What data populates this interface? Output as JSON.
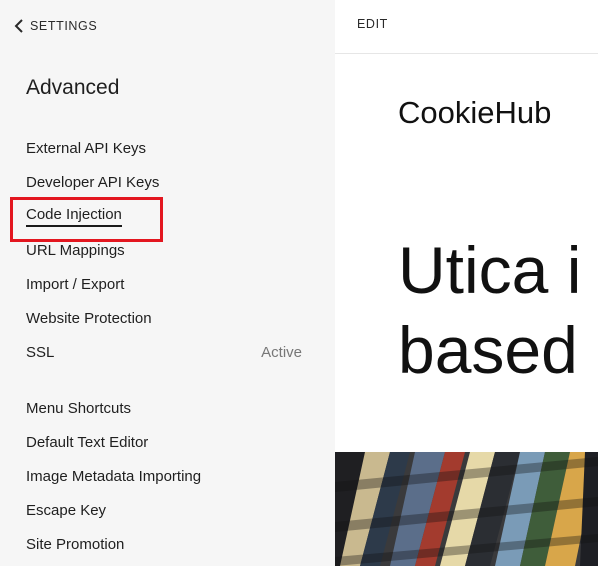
{
  "sidebar": {
    "back_label": "SETTINGS",
    "title": "Advanced",
    "items": [
      {
        "label": "External API Keys",
        "status": ""
      },
      {
        "label": "Developer API Keys",
        "status": ""
      },
      {
        "label": "Code Injection",
        "status": ""
      },
      {
        "label": "URL Mappings",
        "status": ""
      },
      {
        "label": "Import / Export",
        "status": ""
      },
      {
        "label": "Website Protection",
        "status": ""
      },
      {
        "label": "SSL",
        "status": "Active"
      },
      {
        "label": "Menu Shortcuts",
        "status": ""
      },
      {
        "label": "Default Text Editor",
        "status": ""
      },
      {
        "label": "Image Metadata Importing",
        "status": ""
      },
      {
        "label": "Escape Key",
        "status": ""
      },
      {
        "label": "Site Promotion",
        "status": ""
      }
    ],
    "selected_item": "Code Injection"
  },
  "preview": {
    "edit_label": "EDIT",
    "site_name": "CookieHub",
    "hero_line1": "Utica i",
    "hero_line2": "based"
  },
  "colors": {
    "sidebar_bg": "#f6f6f6",
    "highlight": "#e3161f"
  },
  "icons": {
    "back": "chevron-left-icon"
  }
}
